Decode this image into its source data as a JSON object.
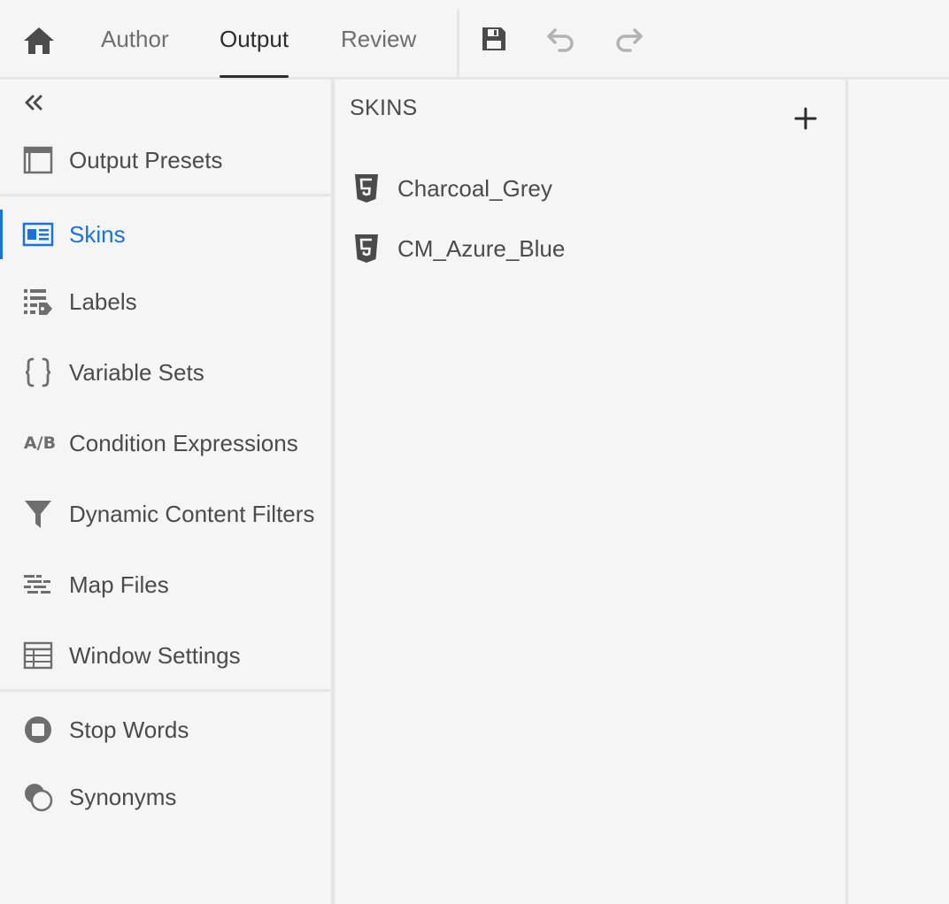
{
  "header": {
    "home_icon": "home-icon",
    "tabs": [
      {
        "label": "Author"
      },
      {
        "label": "Output"
      },
      {
        "label": "Review"
      }
    ],
    "active_tab": "Output",
    "tools": [
      "save-icon",
      "undo-icon",
      "redo-icon"
    ]
  },
  "sidebar": {
    "collapse_icon": "double-chevron-left-icon",
    "items": [
      {
        "label": "Output Presets",
        "icon": "output-presets-icon"
      },
      {
        "label": "Skins",
        "icon": "skins-icon",
        "active": true
      },
      {
        "label": "Labels",
        "icon": "labels-icon"
      },
      {
        "label": "Variable Sets",
        "icon": "curly-braces-icon"
      },
      {
        "label": "Condition Expressions",
        "icon": "a-b-icon",
        "icon_text": "A/B"
      },
      {
        "label": "Dynamic Content Filters",
        "icon": "filter-icon"
      },
      {
        "label": "Map Files",
        "icon": "map-files-icon"
      },
      {
        "label": "Window Settings",
        "icon": "table-icon"
      },
      {
        "label": "Stop Words",
        "icon": "stop-icon"
      },
      {
        "label": "Synonyms",
        "icon": "synonyms-icon"
      }
    ]
  },
  "skins_panel": {
    "title": "SKINS",
    "add_icon": "plus-icon",
    "skins": [
      {
        "name": "Charcoal_Grey",
        "icon": "html5-icon"
      },
      {
        "name": "CM_Azure_Blue",
        "icon": "html5-icon"
      }
    ]
  },
  "colors": {
    "background": "#f5f5f5",
    "accent": "#1473e6",
    "text": "#4b4b4b",
    "divider": "#e6e6e6"
  }
}
